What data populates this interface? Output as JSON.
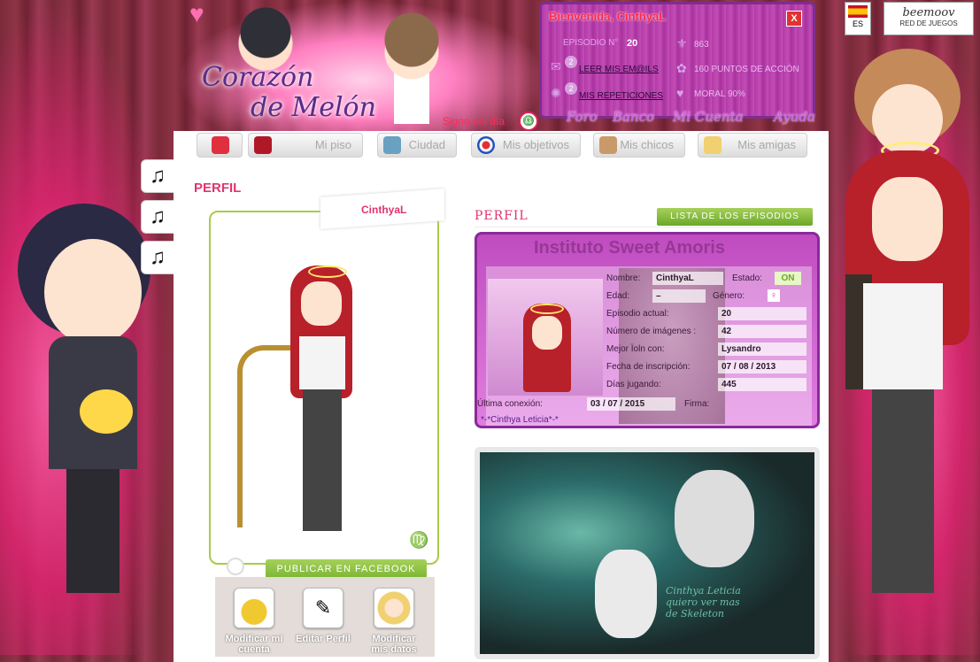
{
  "welcome": {
    "title": "Bienvenida, CinthyaL",
    "episode_label": "EPISODIO N°",
    "episode_value": "20",
    "mails_count": "2",
    "mails_link": "LEER MIS EM@ILS",
    "reps_count": "2",
    "reps_link": "MIS REPETICIONES",
    "pa_value": "863",
    "action_points": "160 PUNTOS DE ACCIÓN",
    "moral": "MORAL 90%",
    "close_label": "X",
    "links": [
      "Foro",
      "Banco",
      "Mi Cuenta",
      "Ayuda"
    ]
  },
  "header": {
    "logo_line1": "Corazón",
    "logo_line2": "de Melón",
    "signo_label": "Signo del día",
    "signo_icon": "♎"
  },
  "lang": {
    "code": "ES"
  },
  "beemoov": {
    "name": "beemoov",
    "tagline": "RED DE JUEGOS"
  },
  "nav": {
    "items": [
      {
        "label": "",
        "icon": "home-icon"
      },
      {
        "label": "Mi piso",
        "icon": "sofa-icon"
      },
      {
        "label": "Ciudad",
        "icon": "city-icon"
      },
      {
        "label": "Mis objetivos",
        "icon": "target-icon"
      },
      {
        "label": "Mis chicos",
        "icon": "boy-icon"
      },
      {
        "label": "Mis amigas",
        "icon": "girl-icon"
      }
    ]
  },
  "music_icon": "♫",
  "page": {
    "title": "PERFIL",
    "username": "CinthyaL",
    "zodiac": "♍",
    "fb_button": "PUBLICAR EN FACEBOOK",
    "actions": [
      "Modificar mi cuenta",
      "Editar Perfil",
      "Modificar mis datos"
    ]
  },
  "profile": {
    "heading": "PERFIL",
    "ep_list_button": "LISTA DE LOS EPISODIOS",
    "card_title": "Instituto Sweet Amoris",
    "fields": {
      "nombre_label": "Nombre:",
      "nombre": "CinthyaL",
      "estado_label": "Estado:",
      "estado": "ON",
      "edad_label": "Edad:",
      "edad": "–",
      "genero_label": "Género:",
      "genero_icon": "♀",
      "episodio_label": "Episodio actual:",
      "episodio": "20",
      "imagenes_label": "Número de imágenes :",
      "imagenes": "42",
      "mejor_label": "Mejor Ïoln con:",
      "mejor": "Lysandro",
      "fecha_label": "Fecha de inscripción:",
      "fecha": "07 / 08 / 2013",
      "dias_label": "Días jugando:",
      "dias": "445",
      "ultima_label": "Última conexión:",
      "ultima": "03 / 07 / 2015",
      "firma_label": "Firma:",
      "firma": "*-*Cinthya Leticia*-*"
    }
  },
  "image_signature": "Cinthya Leticia\nquiero ver mas\nde Skeleton"
}
